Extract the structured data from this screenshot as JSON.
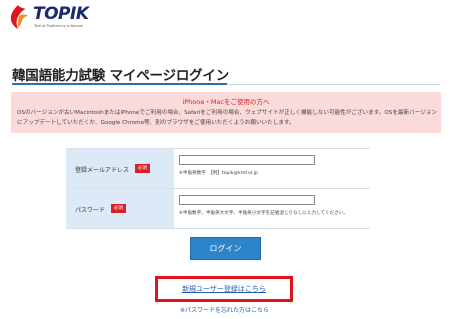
{
  "header": {
    "logo_text": "TOPIK",
    "logo_subtitle": "Test of Proficiency in Korean"
  },
  "page": {
    "title": "韓国語能力試験 マイページログイン"
  },
  "notice": {
    "title": "iPhone・Macをご使用の方へ",
    "body": "OSのバージョンが古いMacintoshまたはiPhoneでご利用の場合、Safariをご利用の場合、ウェブサイトが正しく機能しない可能性がございます。OSを最新バージョンにアップデートしていただくか、Google Chrome等、別のブラウザをご使用いただくようお願いいたします。"
  },
  "form": {
    "email": {
      "label": "登録メールアドレス",
      "required_badge": "必須",
      "value": "",
      "hint": "※半角英数字　【例】topik@kref.or.jp"
    },
    "password": {
      "label": "パスワード",
      "required_badge": "必須",
      "value": "",
      "hint": "※半角数字、半角英大文字、半角英小文字を記號混じりなしに入力してください。"
    },
    "login_button": "ログイン"
  },
  "links": {
    "register": "新規ユーザー登録はこちら",
    "forgot_password": "※パスワードを忘れた方はこちら"
  },
  "colors": {
    "accent_blue": "#2e84c9",
    "required_red": "#d8202a",
    "notice_bg": "#fbdada",
    "label_bg": "#dbeaf6",
    "highlight_red": "#e0141e"
  }
}
